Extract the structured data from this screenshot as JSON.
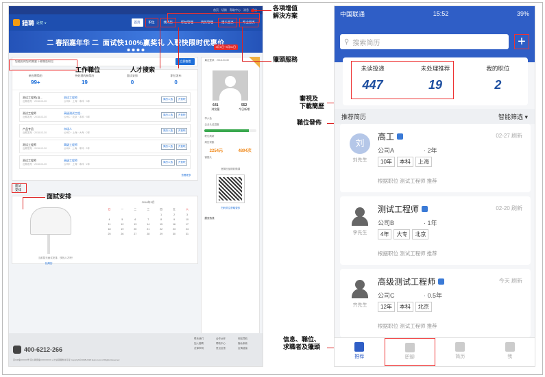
{
  "desktop": {
    "logo": "猎聘",
    "logo_sub": "近初 ∨",
    "topbar": [
      "首页",
      "切换",
      "帮助中心",
      "消息",
      "退出"
    ],
    "nav": [
      "首页",
      "职位",
      "找简历",
      "职位管理",
      "简历管理",
      "猎头服务",
      "专业服务"
    ],
    "banner_left": "二 春招嘉年华 二",
    "banner_right": "面试快100%赢奖礼  入职快限时优惠价",
    "banner_date": "3月1日~3月31日",
    "alert_text": "您能把的您的需要下载哪些职位",
    "alert_btn": "立即查看",
    "stats": [
      {
        "label": "新应聘简历",
        "value": "99+"
      },
      {
        "label": "待处理的新简历",
        "value": "19"
      },
      {
        "label": "面试安排",
        "value": "0"
      },
      {
        "label": "职位发布",
        "value": "0"
      }
    ],
    "rows": [
      {
        "c1": "测试工程师(自...",
        "c1s": "近期发布 · 2018-03-30",
        "c2": "测试工程师",
        "c2s": "公司B · 上海 · 本科 · 3年",
        "b1": "简历人选",
        "b2": "开放职"
      },
      {
        "c1": "测试工程师",
        "c1s": "近期发布 · 2018-03-30",
        "c2": "高级测试工程...",
        "c2s": "公司C · 北京 · 本科 · 5年",
        "b1": "简历人选",
        "b2": "开放职"
      },
      {
        "c1": "产品专员",
        "c1s": "近期发布 · 2018-03-30",
        "c2": "市场人",
        "c2s": "公司D · 上海 · 大专 · 2年",
        "b1": "简历人选",
        "b2": "开放职"
      },
      {
        "c1": "测试工程师",
        "c1s": "近期发布 · 2018-03-30",
        "c2": "高级工程师",
        "c2s": "公司A · 上海 · 本科 · 2年",
        "b1": "简历人选",
        "b2": "开放职"
      },
      {
        "c1": "测试工程师",
        "c1s": "近期发布 · 2018-03-30",
        "c2": "高级工程师",
        "c2s": "公司E · 上海 · 本科 · 2年",
        "b1": "简历人选",
        "b2": "开放职"
      }
    ],
    "more": "查看更多",
    "sched_tab": "面试安排",
    "mailbox_text": "当前暂无面试安排，快找人才吧！",
    "mailbox_link": "找简历",
    "calendar_title": "2018年3月",
    "calendar_head": [
      "日",
      "一",
      "二",
      "三",
      "四",
      "五",
      "六"
    ],
    "calendar_days": [
      "",
      "",
      "",
      "",
      "1",
      "2",
      "3",
      "4",
      "5",
      "6",
      "7",
      "8",
      "9",
      "10",
      "11",
      "12",
      "13",
      "14",
      "15",
      "16",
      "17",
      "18",
      "19",
      "20",
      "21",
      "22",
      "23",
      "24",
      "25",
      "26",
      "27",
      "28",
      "29",
      "30",
      "31"
    ],
    "profile_title": "最近登录：2018-03-30",
    "profile_stats": [
      {
        "v": "641",
        "l": "浏览量"
      },
      {
        "v": "552",
        "l": "今日新增"
      }
    ],
    "user_name": "李六会",
    "progress": 0.85,
    "profile_small": [
      "企业认证进度",
      "职位刷新",
      "简历采集",
      "微猎头"
    ],
    "num1": "2254元",
    "num2": "4894次",
    "qr_title": "官微出品精彩微课",
    "qr_caption": "扫码关注获取更多",
    "contact_title": "服务热线",
    "footer_phone": "400-6212-266",
    "footer_small": "京ICP备XXXXX号 京公网安备XXXXXXXX 人力资源服务许可证 Copyright©2008-2018 liepin.com All Rights Reserved",
    "footer_links": [
      "联系我们",
      "合作伙伴",
      "网站导航",
      "加入猎聘",
      "帮助中心",
      "隐私条款",
      "法律声明",
      "意见反馈",
      "友情链接"
    ]
  },
  "annotations": {
    "value_added": "各項增值\n解決方案",
    "headhunt": "獵頭服務",
    "job_post": "工作職位",
    "talent_search": "人才搜索",
    "interview": "面試安排",
    "review": "審視及\n下載簡歷",
    "post_job": "職位發佈",
    "messages": "信息、職位、\n求職者及獵頭"
  },
  "phone": {
    "carrier": "中国联通",
    "time": "15:52",
    "battery": "39%",
    "search_placeholder": "搜索简历",
    "plus": "+",
    "stats": [
      {
        "label": "未读投递",
        "value": "447"
      },
      {
        "label": "未处理推荐",
        "value": "19"
      },
      {
        "label": "我的职位",
        "value": "2"
      }
    ],
    "reco_title": "推荐简历",
    "reco_filter": "智能筛选 ▾",
    "cards": [
      {
        "avatar": "刘",
        "cname": "刘先生",
        "title": "高工",
        "date": "02-27 刷新",
        "co": "公司A",
        "yrs": "· 2年",
        "tags": [
          "10年",
          "本科",
          "上海"
        ],
        "note": "根据职位 测试工程师 推荐"
      },
      {
        "avatar": "",
        "cname": "李先生",
        "title": "测试工程师",
        "date": "02-20 刷新",
        "co": "公司B",
        "yrs": "· 1年",
        "tags": [
          "4年",
          "大专",
          "北京"
        ],
        "note": "根据职位 测试工程师 推荐"
      },
      {
        "avatar": "",
        "cname": "齐先生",
        "title": "高级测试工程师",
        "date": "今天 刷新",
        "co": "公司C",
        "yrs": "· 0.5年",
        "tags": [
          "12年",
          "本科",
          "北京"
        ],
        "note": "根据职位 测试工程师 推荐"
      }
    ],
    "tabs": [
      "推荐",
      "职聊",
      "简历",
      "我"
    ]
  }
}
